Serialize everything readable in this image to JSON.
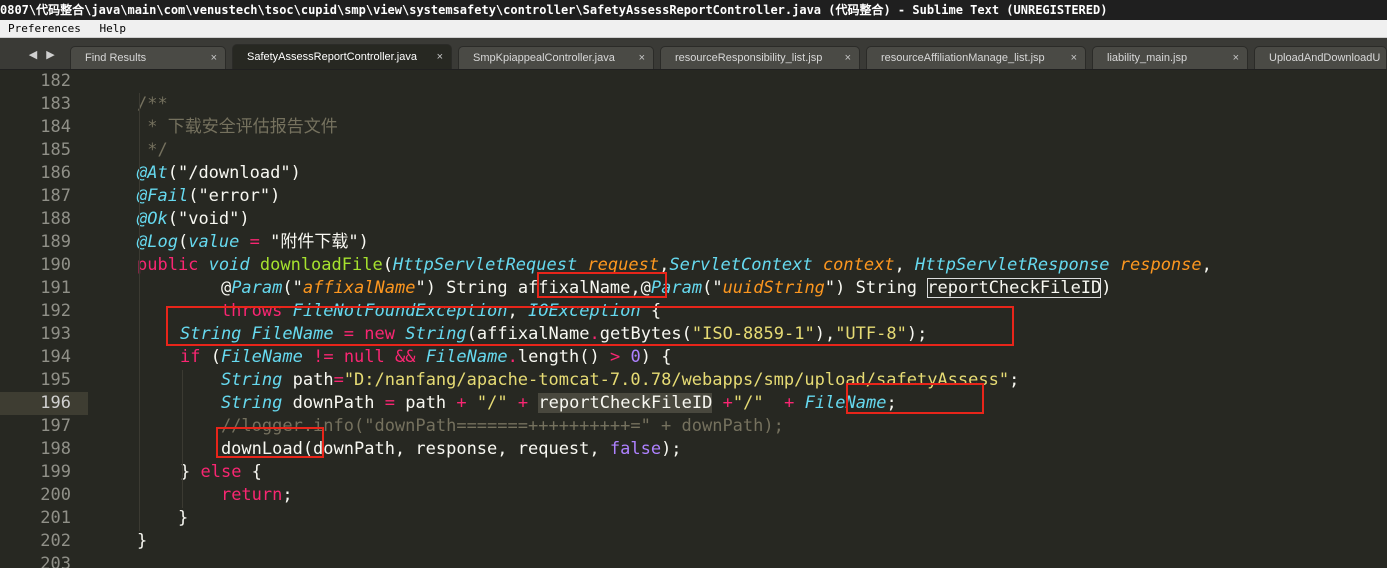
{
  "window": {
    "title": "0807\\代码整合\\java\\main\\com\\venustech\\tsoc\\cupid\\smp\\view\\systemsafety\\controller\\SafetyAssessReportController.java (代码整合) - Sublime Text (UNREGISTERED)"
  },
  "menu": {
    "items": [
      "Preferences",
      "Help"
    ]
  },
  "tabs": [
    {
      "label": "Find Results",
      "active": false
    },
    {
      "label": "SafetyAssessReportController.java",
      "active": true
    },
    {
      "label": "SmpKpiappealController.java",
      "active": false
    },
    {
      "label": "resourceResponsibility_list.jsp",
      "active": false
    },
    {
      "label": "resourceAffiliationManage_list.jsp",
      "active": false
    },
    {
      "label": "liability_main.jsp",
      "active": false
    },
    {
      "label": "UploadAndDownloadU",
      "active": false
    }
  ],
  "tab_nav": {
    "left": "◀",
    "right": "▶"
  },
  "tab_close_glyph": "×",
  "editor": {
    "current_line": 196,
    "lines": [
      {
        "n": "182",
        "tokens": []
      },
      {
        "n": "183",
        "tokens": [
          {
            "t": "/**",
            "c": "comment"
          }
        ]
      },
      {
        "n": "184",
        "tokens": [
          {
            "t": " * 下载安全评估报告文件",
            "c": "comment"
          }
        ]
      },
      {
        "n": "185",
        "tokens": [
          {
            "t": " */",
            "c": "comment"
          }
        ]
      },
      {
        "n": "186",
        "tokens": [
          {
            "t": "@At",
            "c": "anno"
          },
          {
            "t": "(",
            "c": "plain"
          },
          {
            "t": "\"/download\"",
            "c": "plain"
          },
          {
            "t": ")",
            "c": "plain"
          }
        ]
      },
      {
        "n": "187",
        "tokens": [
          {
            "t": "@Fail",
            "c": "anno"
          },
          {
            "t": "(",
            "c": "plain"
          },
          {
            "t": "\"error\"",
            "c": "plain"
          },
          {
            "t": ")",
            "c": "plain"
          }
        ]
      },
      {
        "n": "188",
        "tokens": [
          {
            "t": "@Ok",
            "c": "anno"
          },
          {
            "t": "(",
            "c": "plain"
          },
          {
            "t": "\"void\"",
            "c": "plain"
          },
          {
            "t": ")",
            "c": "plain"
          }
        ]
      },
      {
        "n": "189",
        "tokens": [
          {
            "t": "@Log",
            "c": "anno"
          },
          {
            "t": "(",
            "c": "plain"
          },
          {
            "t": "value",
            "c": "type"
          },
          {
            "t": " = ",
            "c": "key"
          },
          {
            "t": "\"附件下载\"",
            "c": "plain"
          },
          {
            "t": ")",
            "c": "plain"
          }
        ]
      },
      {
        "n": "190",
        "tokens": [
          {
            "t": "public",
            "c": "key"
          },
          {
            "t": " ",
            "c": "plain"
          },
          {
            "t": "void",
            "c": "type"
          },
          {
            "t": " ",
            "c": "plain"
          },
          {
            "t": "downloadFile",
            "c": "func"
          },
          {
            "t": "(",
            "c": "plain"
          },
          {
            "t": "HttpServletRequest",
            "c": "type"
          },
          {
            "t": " ",
            "c": "plain"
          },
          {
            "t": "request",
            "c": "param"
          },
          {
            "t": ",",
            "c": "plain"
          },
          {
            "t": "ServletContext",
            "c": "type"
          },
          {
            "t": " ",
            "c": "plain"
          },
          {
            "t": "context",
            "c": "param"
          },
          {
            "t": ", ",
            "c": "plain"
          },
          {
            "t": "HttpServletResponse",
            "c": "type"
          },
          {
            "t": " ",
            "c": "plain"
          },
          {
            "t": "response",
            "c": "param"
          },
          {
            "t": ",",
            "c": "plain"
          }
        ]
      },
      {
        "n": "191",
        "tokens": [
          {
            "t": "    @",
            "c": "plain"
          },
          {
            "t": "Param",
            "c": "anno"
          },
          {
            "t": "(\"",
            "c": "plain"
          },
          {
            "t": "affixalName",
            "c": "param"
          },
          {
            "t": "\") String ",
            "c": "plain"
          },
          {
            "t": "affixalName",
            "c": "plain"
          },
          {
            "t": ",@",
            "c": "plain"
          },
          {
            "t": "Param",
            "c": "anno"
          },
          {
            "t": "(\"",
            "c": "plain"
          },
          {
            "t": "uuidString",
            "c": "param"
          },
          {
            "t": "\") String ",
            "c": "plain"
          },
          {
            "t": "reportCheckFileID",
            "c": "boxed"
          },
          {
            "t": ")",
            "c": "plain"
          }
        ]
      },
      {
        "n": "192",
        "tokens": [
          {
            "t": "    throws ",
            "c": "key"
          },
          {
            "t": "FileNotFoundException",
            "c": "type"
          },
          {
            "t": ", ",
            "c": "plain"
          },
          {
            "t": "IOException",
            "c": "type"
          },
          {
            "t": " {",
            "c": "plain"
          }
        ]
      },
      {
        "n": "193",
        "tokens": [
          {
            "t": "String",
            "c": "type"
          },
          {
            "t": " ",
            "c": "plain"
          },
          {
            "t": "FileName",
            "c": "type"
          },
          {
            "t": " = ",
            "c": "key"
          },
          {
            "t": "new",
            "c": "key"
          },
          {
            "t": " ",
            "c": "plain"
          },
          {
            "t": "String",
            "c": "type"
          },
          {
            "t": "(affixalName",
            "c": "plain"
          },
          {
            "t": ".",
            "c": "key"
          },
          {
            "t": "getBytes(",
            "c": "plain"
          },
          {
            "t": "\"ISO-8859-1\"",
            "c": "str"
          },
          {
            "t": "),",
            "c": "plain"
          },
          {
            "t": "\"UTF-8\"",
            "c": "str"
          },
          {
            "t": ");",
            "c": "plain"
          }
        ]
      },
      {
        "n": "194",
        "tokens": [
          {
            "t": "if",
            "c": "key"
          },
          {
            "t": " (",
            "c": "plain"
          },
          {
            "t": "FileName",
            "c": "type"
          },
          {
            "t": " != ",
            "c": "key"
          },
          {
            "t": "null",
            "c": "key"
          },
          {
            "t": " && ",
            "c": "key"
          },
          {
            "t": "FileName",
            "c": "type"
          },
          {
            "t": ".",
            "c": "key"
          },
          {
            "t": "length() ",
            "c": "plain"
          },
          {
            "t": ">",
            "c": "key"
          },
          {
            "t": " ",
            "c": "plain"
          },
          {
            "t": "0",
            "c": "num"
          },
          {
            "t": ") {",
            "c": "plain"
          }
        ]
      },
      {
        "n": "195",
        "tokens": [
          {
            "t": "    ",
            "c": "plain"
          },
          {
            "t": "String",
            "c": "type"
          },
          {
            "t": " path",
            "c": "plain"
          },
          {
            "t": "=",
            "c": "key"
          },
          {
            "t": "\"D:/nanfang/apache-tomcat-7.0.78/webapps/smp/upload/safetyAssess\"",
            "c": "str"
          },
          {
            "t": ";",
            "c": "plain"
          }
        ]
      },
      {
        "n": "196",
        "tokens": [
          {
            "t": "    ",
            "c": "plain"
          },
          {
            "t": "String",
            "c": "type"
          },
          {
            "t": " downPath ",
            "c": "plain"
          },
          {
            "t": "=",
            "c": "key"
          },
          {
            "t": " path ",
            "c": "plain"
          },
          {
            "t": "+",
            "c": "key"
          },
          {
            "t": " ",
            "c": "plain"
          },
          {
            "t": "\"/\"",
            "c": "str"
          },
          {
            "t": " ",
            "c": "plain"
          },
          {
            "t": "+",
            "c": "key"
          },
          {
            "t": " ",
            "c": "plain"
          },
          {
            "t": "reportCheckFileID",
            "c": "sel"
          },
          {
            "t": " ",
            "c": "plain"
          },
          {
            "t": "+",
            "c": "key"
          },
          {
            "t": "\"/\"",
            "c": "str"
          },
          {
            "t": "  ",
            "c": "plain"
          },
          {
            "t": "+",
            "c": "key"
          },
          {
            "t": " ",
            "c": "plain"
          },
          {
            "t": "FileName",
            "c": "type"
          },
          {
            "t": ";",
            "c": "plain"
          }
        ]
      },
      {
        "n": "197",
        "tokens": [
          {
            "t": "    //logger.info(\"downPath=======++++++++++=\" + downPath);",
            "c": "comment"
          }
        ]
      },
      {
        "n": "198",
        "tokens": [
          {
            "t": "    downLoad(downPath, response, request, ",
            "c": "plain"
          },
          {
            "t": "false",
            "c": "num"
          },
          {
            "t": ");",
            "c": "plain"
          }
        ]
      },
      {
        "n": "199",
        "tokens": [
          {
            "t": "} ",
            "c": "plain"
          },
          {
            "t": "else",
            "c": "key"
          },
          {
            "t": " {",
            "c": "plain"
          }
        ]
      },
      {
        "n": "200",
        "tokens": [
          {
            "t": "    ",
            "c": "plain"
          },
          {
            "t": "return",
            "c": "key"
          },
          {
            "t": ";",
            "c": "plain"
          }
        ]
      },
      {
        "n": "201",
        "tokens": [
          {
            "t": "    }",
            "c": "plain"
          }
        ]
      },
      {
        "n": "202",
        "tokens": [
          {
            "t": "}",
            "c": "plain"
          }
        ]
      },
      {
        "n": "203",
        "tokens": []
      }
    ]
  }
}
